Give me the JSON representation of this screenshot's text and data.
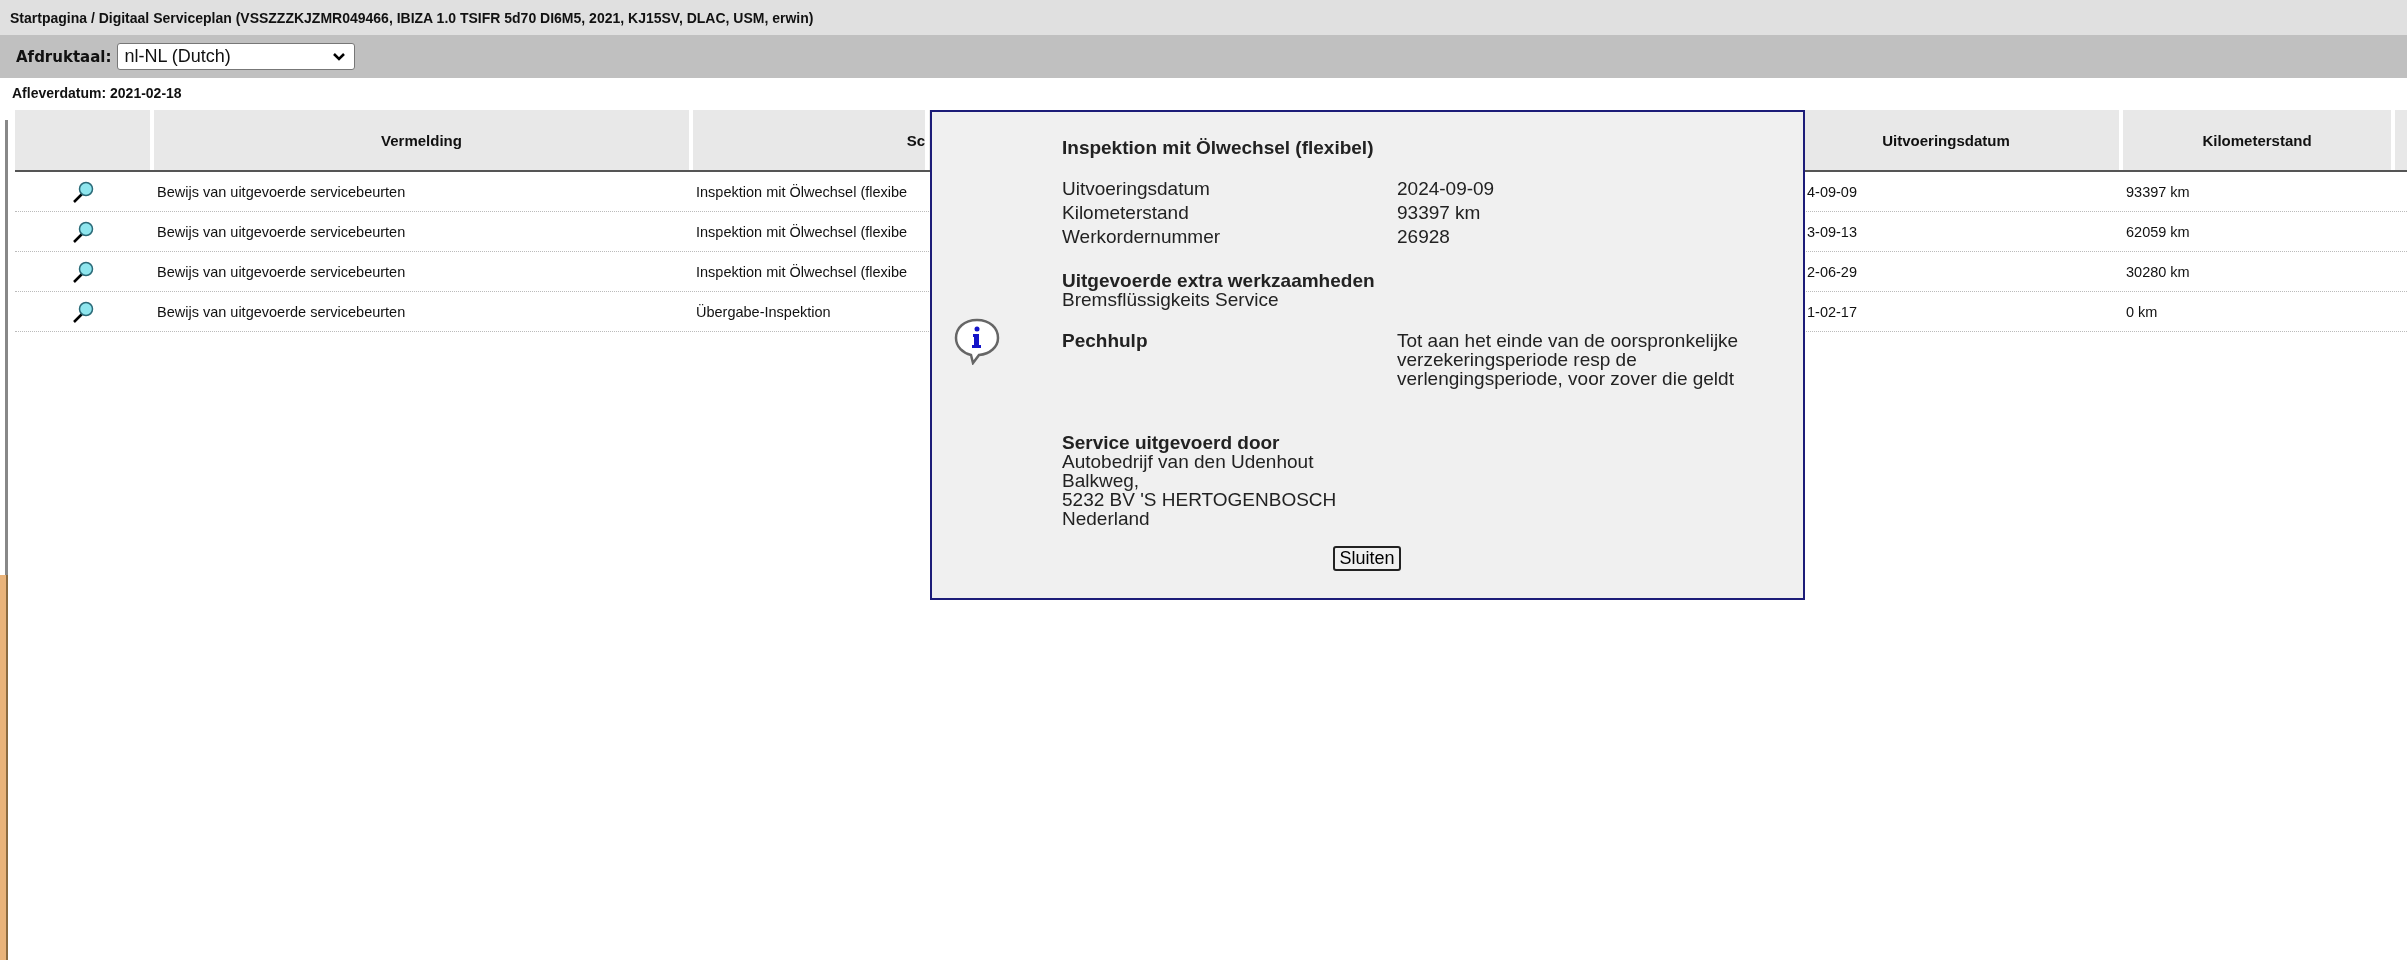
{
  "breadcrumb": "Startpagina / Digitaal Serviceplan (VSSZZZKJZMR049466, IBIZA 1.0 TSIFR 5d70 DI6M5, 2021, KJ15SV, DLAC, USM, erwin)",
  "print_language": {
    "label": "Afdruktaal:",
    "value": "nl-NL (Dutch)"
  },
  "delivery_date": "Afleverdatum: 2021-02-18",
  "table": {
    "columns": [
      "Vermelding",
      "Sc",
      "Uitvoeringsdatum",
      "Kilometerstand"
    ],
    "rows": [
      {
        "entry": "Bewijs van uitgevoerde servicebeurten",
        "column_3": "Inspektion mit Ölwechsel (flexibe",
        "date": "4-09-09",
        "mileage": "93397 km"
      },
      {
        "entry": "Bewijs van uitgevoerde servicebeurten",
        "column_3": "Inspektion mit Ölwechsel (flexibe",
        "date": "3-09-13",
        "mileage": "62059 km"
      },
      {
        "entry": "Bewijs van uitgevoerde servicebeurten",
        "column_3": "Inspektion mit Ölwechsel (flexibe",
        "date": "2-06-29",
        "mileage": "30280 km"
      },
      {
        "entry": "Bewijs van uitgevoerde servicebeurten",
        "column_3": "Übergabe-Inspektion",
        "date": "1-02-17",
        "mileage": "0 km"
      }
    ]
  },
  "dialog": {
    "title": "Inspektion mit Ölwechsel (flexibel)",
    "fields": [
      {
        "label": "Uitvoeringsdatum",
        "value": "2024-09-09"
      },
      {
        "label": "Kilometerstand",
        "value": "93397 km"
      },
      {
        "label": "Werkordernummer",
        "value": "26928"
      }
    ],
    "extra_work": {
      "heading": "Uitgevoerde extra werkzaamheden",
      "text": "Bremsflüssigkeits Service"
    },
    "roadside": {
      "heading": "Pechhulp",
      "text": "Tot aan het einde van de oorspronkelijke verzekeringsperiode resp de verlengingsperiode, voor zover die geldt"
    },
    "performed_by": {
      "heading": "Service uitgevoerd door",
      "lines": [
        "Autobedrijf van den Udenhout",
        "Balkweg,",
        "5232 BV 'S HERTOGENBOSCH",
        "Nederland"
      ]
    },
    "close_button": "Sluiten"
  }
}
